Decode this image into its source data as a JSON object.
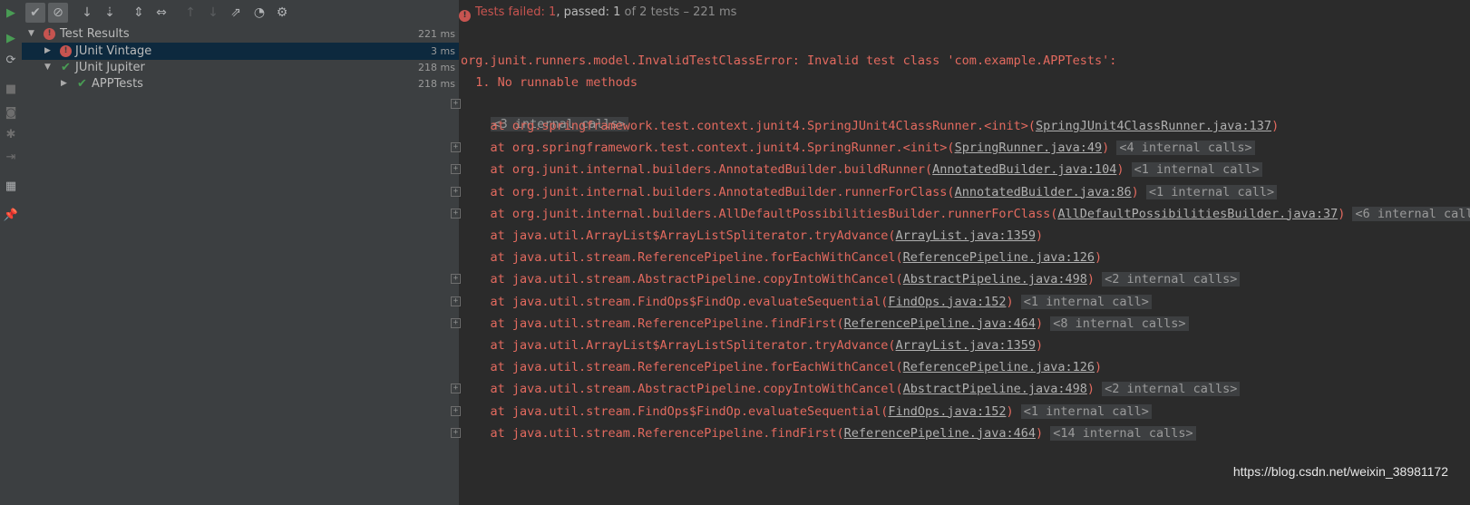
{
  "toolbar": {
    "run_icon": "play-icon",
    "buttons": [
      "show-passed-icon",
      "show-ignored-icon",
      "sort-alpha-icon",
      "sort-duration-icon",
      "expand-all-icon",
      "collapse-all-icon",
      "prev-failed-icon",
      "next-failed-icon",
      "export-icon",
      "history-icon",
      "settings-icon"
    ]
  },
  "status": {
    "failed_label": "Tests failed: 1",
    "passed_label": ", passed: 1",
    "rest": " of 2 tests – 221 ms"
  },
  "tree": {
    "root": {
      "label": "Test Results",
      "time": "221 ms",
      "status": "failed"
    },
    "items": [
      {
        "label": "JUnit Vintage",
        "time": "3 ms",
        "status": "failed",
        "selected": true
      },
      {
        "label": "JUnit Jupiter",
        "time": "218 ms",
        "status": "passed"
      },
      {
        "label": "APPTests",
        "time": "218 ms",
        "status": "passed"
      }
    ]
  },
  "console": {
    "error": "org.junit.runners.model.InvalidTestClassError: Invalid test class 'com.example.APPTests':",
    "reason": "  1. No runnable methods",
    "first_calls": "<3 internal calls>",
    "frames": [
      {
        "fold": false,
        "text": "    at org.springframework.test.context.junit4.SpringJUnit4ClassRunner.<init>(",
        "link": "SpringJUnit4ClassRunner.java:137",
        "after": ")",
        "calls": ""
      },
      {
        "fold": true,
        "text": "    at org.springframework.test.context.junit4.SpringRunner.<init>(",
        "link": "SpringRunner.java:49",
        "after": ") ",
        "calls": "<4 internal calls>"
      },
      {
        "fold": true,
        "text": "    at org.junit.internal.builders.AnnotatedBuilder.buildRunner(",
        "link": "AnnotatedBuilder.java:104",
        "after": ") ",
        "calls": "<1 internal call>"
      },
      {
        "fold": true,
        "text": "    at org.junit.internal.builders.AnnotatedBuilder.runnerForClass(",
        "link": "AnnotatedBuilder.java:86",
        "after": ") ",
        "calls": "<1 internal call>"
      },
      {
        "fold": true,
        "text": "    at org.junit.internal.builders.AllDefaultPossibilitiesBuilder.runnerForClass(",
        "link": "AllDefaultPossibilitiesBuilder.java:37",
        "after": ") ",
        "calls": "<6 internal call"
      },
      {
        "fold": false,
        "text": "    at java.util.ArrayList$ArrayListSpliterator.tryAdvance(",
        "link": "ArrayList.java:1359",
        "after": ")",
        "calls": ""
      },
      {
        "fold": false,
        "text": "    at java.util.stream.ReferencePipeline.forEachWithCancel(",
        "link": "ReferencePipeline.java:126",
        "after": ")",
        "calls": ""
      },
      {
        "fold": true,
        "text": "    at java.util.stream.AbstractPipeline.copyIntoWithCancel(",
        "link": "AbstractPipeline.java:498",
        "after": ") ",
        "calls": "<2 internal calls>"
      },
      {
        "fold": true,
        "text": "    at java.util.stream.FindOps$FindOp.evaluateSequential(",
        "link": "FindOps.java:152",
        "after": ") ",
        "calls": "<1 internal call>"
      },
      {
        "fold": true,
        "text": "    at java.util.stream.ReferencePipeline.findFirst(",
        "link": "ReferencePipeline.java:464",
        "after": ") ",
        "calls": "<8 internal calls>"
      },
      {
        "fold": false,
        "text": "    at java.util.ArrayList$ArrayListSpliterator.tryAdvance(",
        "link": "ArrayList.java:1359",
        "after": ")",
        "calls": ""
      },
      {
        "fold": false,
        "text": "    at java.util.stream.ReferencePipeline.forEachWithCancel(",
        "link": "ReferencePipeline.java:126",
        "after": ")",
        "calls": ""
      },
      {
        "fold": true,
        "text": "    at java.util.stream.AbstractPipeline.copyIntoWithCancel(",
        "link": "AbstractPipeline.java:498",
        "after": ") ",
        "calls": "<2 internal calls>"
      },
      {
        "fold": true,
        "text": "    at java.util.stream.FindOps$FindOp.evaluateSequential(",
        "link": "FindOps.java:152",
        "after": ") ",
        "calls": "<1 internal call>"
      },
      {
        "fold": true,
        "text": "    at java.util.stream.ReferencePipeline.findFirst(",
        "link": "ReferencePipeline.java:464",
        "after": ") ",
        "calls": "<14 internal calls>"
      }
    ]
  },
  "watermark": "https://blog.csdn.net/weixin_38981172",
  "colors": {
    "error": "#e36a5f",
    "fail": "#c75450",
    "pass": "#499c54",
    "selection": "#0d293e"
  }
}
